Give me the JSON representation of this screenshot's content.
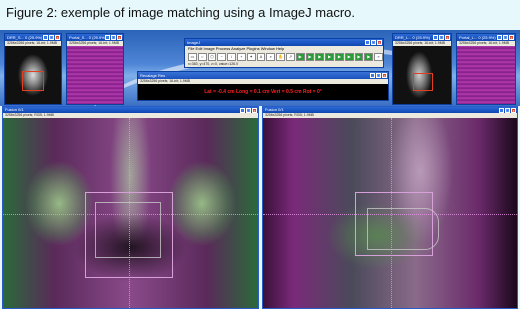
{
  "caption": "Figure 2:  exemple of image matching using a ImageJ macro.",
  "thumbs": [
    {
      "title": "DRR_S... 0 (25.9%)",
      "info": "3256x3256 pixels; 16-bit; 1.9MB"
    },
    {
      "title": "Portal_S... 0 (25.9%)",
      "info": "3256x3256 pixels; 16-bit; 1.9MB"
    },
    {
      "title": "DRR_L... 0 (25.9%)",
      "info": "3256x3256 pixels; 16-bit; 1.9MB"
    },
    {
      "title": "Portal_L... 0 (25.9%)",
      "info": "3256x3256 pixels; 16-bit; 1.9MB"
    }
  ],
  "imagej": {
    "title": "ImageJ",
    "menus": "File  Edit  Image  Process  Analyze  Plugins  Window  Help",
    "coords": "x=363, y=470, z=0, value=126.0"
  },
  "result": {
    "title": "Recalage Res",
    "sub": "3256x3256 pixels; 16-bit; 1.9MB",
    "message": "Lat  = -0.4 cm  Long = 0.1 cm   Vert  = 0.5 cm Rot  = 0°"
  },
  "main": [
    {
      "title": "Fusion 0/1",
      "info": "3256x3256 pixels; RGB; 1.9MB"
    },
    {
      "title": "Fusion 0/1",
      "info": "3256x3256 pixels; RGB; 1.9MB"
    }
  ]
}
